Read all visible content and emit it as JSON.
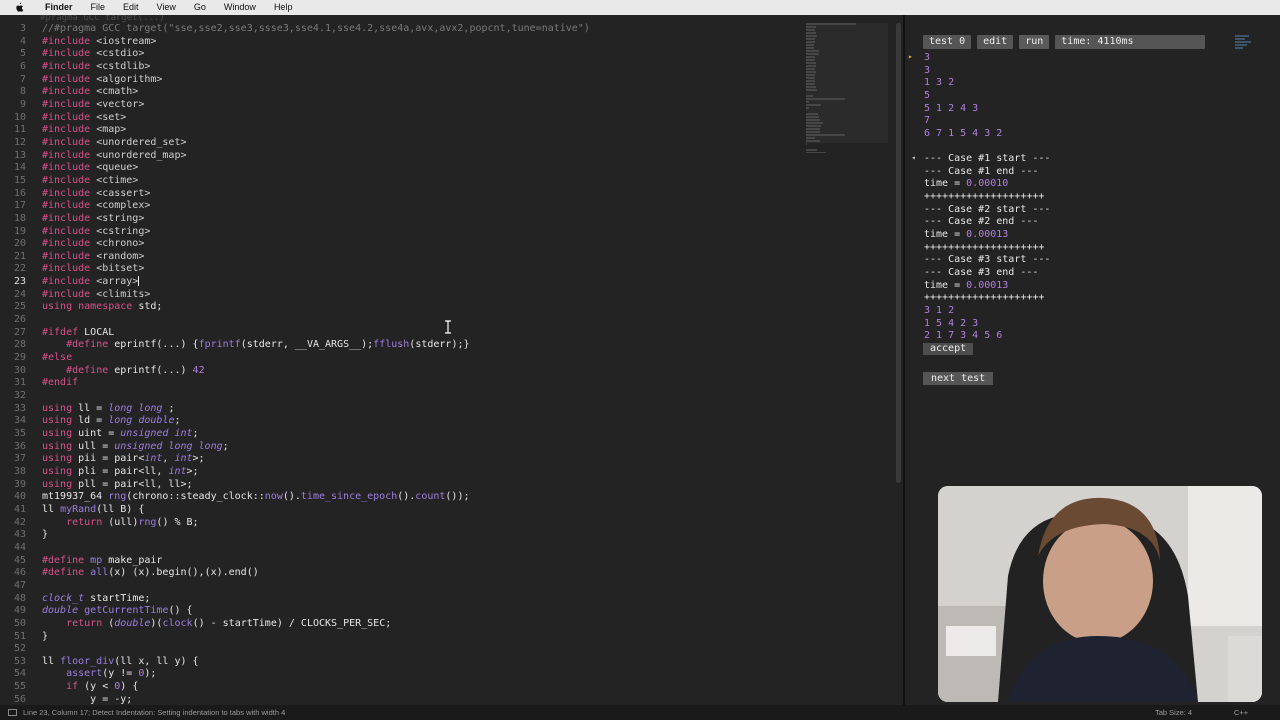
{
  "menubar": {
    "items": [
      "Finder",
      "File",
      "Edit",
      "View",
      "Go",
      "Window",
      "Help"
    ]
  },
  "editor": {
    "partial_top_line": "#pragma GCC target(...)",
    "current_line": 23,
    "lines": [
      {
        "n": "3",
        "segs": [
          [
            "cm",
            "//#pragma GCC target(\"sse,sse2,sse3,ssse3,sse4.1,sse4.2,sse4a,avx,avx2,popcnt,tune=native\")"
          ]
        ]
      },
      {
        "n": "4",
        "segs": [
          [
            "pp",
            "#include "
          ],
          [
            "st",
            "<iostream>"
          ]
        ]
      },
      {
        "n": "5",
        "segs": [
          [
            "pp",
            "#include "
          ],
          [
            "st",
            "<cstdio>"
          ]
        ]
      },
      {
        "n": "6",
        "segs": [
          [
            "pp",
            "#include "
          ],
          [
            "st",
            "<cstdlib>"
          ]
        ]
      },
      {
        "n": "7",
        "segs": [
          [
            "pp",
            "#include "
          ],
          [
            "st",
            "<algorithm>"
          ]
        ]
      },
      {
        "n": "8",
        "segs": [
          [
            "pp",
            "#include "
          ],
          [
            "st",
            "<cmath>"
          ]
        ]
      },
      {
        "n": "9",
        "segs": [
          [
            "pp",
            "#include "
          ],
          [
            "st",
            "<vector>"
          ]
        ]
      },
      {
        "n": "10",
        "segs": [
          [
            "pp",
            "#include "
          ],
          [
            "st",
            "<set>"
          ]
        ]
      },
      {
        "n": "11",
        "segs": [
          [
            "pp",
            "#include "
          ],
          [
            "st",
            "<map>"
          ]
        ]
      },
      {
        "n": "12",
        "segs": [
          [
            "pp",
            "#include "
          ],
          [
            "st",
            "<unordered_set>"
          ]
        ]
      },
      {
        "n": "13",
        "segs": [
          [
            "pp",
            "#include "
          ],
          [
            "st",
            "<unordered_map>"
          ]
        ]
      },
      {
        "n": "14",
        "segs": [
          [
            "pp",
            "#include "
          ],
          [
            "st",
            "<queue>"
          ]
        ]
      },
      {
        "n": "15",
        "segs": [
          [
            "pp",
            "#include "
          ],
          [
            "st",
            "<ctime>"
          ]
        ]
      },
      {
        "n": "16",
        "segs": [
          [
            "pp",
            "#include "
          ],
          [
            "st",
            "<cassert>"
          ]
        ]
      },
      {
        "n": "17",
        "segs": [
          [
            "pp",
            "#include "
          ],
          [
            "st",
            "<complex>"
          ]
        ]
      },
      {
        "n": "18",
        "segs": [
          [
            "pp",
            "#include "
          ],
          [
            "st",
            "<string>"
          ]
        ]
      },
      {
        "n": "19",
        "segs": [
          [
            "pp",
            "#include "
          ],
          [
            "st",
            "<cstring>"
          ]
        ]
      },
      {
        "n": "20",
        "segs": [
          [
            "pp",
            "#include "
          ],
          [
            "st",
            "<chrono>"
          ]
        ]
      },
      {
        "n": "21",
        "segs": [
          [
            "pp",
            "#include "
          ],
          [
            "st",
            "<random>"
          ]
        ]
      },
      {
        "n": "22",
        "segs": [
          [
            "pp",
            "#include "
          ],
          [
            "st",
            "<bitset>"
          ]
        ]
      },
      {
        "n": "23",
        "segs": [
          [
            "pp",
            "#include "
          ],
          [
            "st",
            "<array>"
          ]
        ],
        "caret": true
      },
      {
        "n": "24",
        "segs": [
          [
            "pp",
            "#include "
          ],
          [
            "st",
            "<climits>"
          ]
        ]
      },
      {
        "n": "25",
        "segs": [
          [
            "kw",
            "using "
          ],
          [
            "kw",
            "namespace "
          ],
          [
            "",
            "std;"
          ]
        ]
      },
      {
        "n": "26",
        "segs": []
      },
      {
        "n": "27",
        "segs": [
          [
            "pp",
            "#ifdef "
          ],
          [
            "",
            "LOCAL"
          ]
        ]
      },
      {
        "n": "28",
        "segs": [
          [
            "",
            "    "
          ],
          [
            "pp",
            "#define "
          ],
          [
            "",
            "eprintf(...) {"
          ],
          [
            "fn",
            "fprintf"
          ],
          [
            "",
            "(stderr, __VA_ARGS__);"
          ],
          [
            "fn",
            "fflush"
          ],
          [
            "",
            "(stderr);}"
          ]
        ]
      },
      {
        "n": "29",
        "segs": [
          [
            "pp",
            "#else"
          ]
        ]
      },
      {
        "n": "30",
        "segs": [
          [
            "",
            "    "
          ],
          [
            "pp",
            "#define "
          ],
          [
            "",
            "eprintf(...) "
          ],
          [
            "nm",
            "42"
          ]
        ]
      },
      {
        "n": "31",
        "segs": [
          [
            "pp",
            "#endif"
          ]
        ]
      },
      {
        "n": "32",
        "segs": []
      },
      {
        "n": "33",
        "segs": [
          [
            "kw",
            "using "
          ],
          [
            "",
            "ll = "
          ],
          [
            "ty",
            "long long"
          ],
          [
            "",
            " ;"
          ]
        ]
      },
      {
        "n": "34",
        "segs": [
          [
            "kw",
            "using "
          ],
          [
            "",
            "ld = "
          ],
          [
            "ty",
            "long double"
          ],
          [
            "",
            ";"
          ]
        ]
      },
      {
        "n": "35",
        "segs": [
          [
            "kw",
            "using "
          ],
          [
            "",
            "uint = "
          ],
          [
            "ty",
            "unsigned int"
          ],
          [
            "",
            ";"
          ]
        ]
      },
      {
        "n": "36",
        "segs": [
          [
            "kw",
            "using "
          ],
          [
            "",
            "ull = "
          ],
          [
            "ty",
            "unsigned long long"
          ],
          [
            "",
            ";"
          ]
        ]
      },
      {
        "n": "37",
        "segs": [
          [
            "kw",
            "using "
          ],
          [
            "",
            "pii = pair<"
          ],
          [
            "ty",
            "int"
          ],
          [
            "",
            ", "
          ],
          [
            "ty",
            "int"
          ],
          [
            "",
            ">;"
          ]
        ]
      },
      {
        "n": "38",
        "segs": [
          [
            "kw",
            "using "
          ],
          [
            "",
            "pli = pair<ll, "
          ],
          [
            "ty",
            "int"
          ],
          [
            "",
            ">;"
          ]
        ]
      },
      {
        "n": "39",
        "segs": [
          [
            "kw",
            "using "
          ],
          [
            "",
            "pll = pair<ll, ll>;"
          ]
        ]
      },
      {
        "n": "40",
        "segs": [
          [
            "",
            "mt19937_64 "
          ],
          [
            "fn",
            "rng"
          ],
          [
            "",
            "(chrono::steady_clock::"
          ],
          [
            "fn",
            "now"
          ],
          [
            "",
            "()."
          ],
          [
            "fn",
            "time_since_epoch"
          ],
          [
            "",
            "()."
          ],
          [
            "fn",
            "count"
          ],
          [
            "",
            "());"
          ]
        ]
      },
      {
        "n": "41",
        "segs": [
          [
            "",
            "ll "
          ],
          [
            "fn",
            "myRand"
          ],
          [
            "",
            "(ll B) {"
          ]
        ]
      },
      {
        "n": "42",
        "segs": [
          [
            "",
            "    "
          ],
          [
            "kw",
            "return "
          ],
          [
            "",
            "(ull)"
          ],
          [
            "fn",
            "rng"
          ],
          [
            "",
            "() % B;"
          ]
        ]
      },
      {
        "n": "43",
        "segs": [
          [
            "",
            "}"
          ]
        ]
      },
      {
        "n": "44",
        "segs": []
      },
      {
        "n": "45",
        "segs": [
          [
            "pp",
            "#define "
          ],
          [
            "fn",
            "mp "
          ],
          [
            "",
            "make_pair"
          ]
        ]
      },
      {
        "n": "46",
        "segs": [
          [
            "pp",
            "#define "
          ],
          [
            "fn",
            "all"
          ],
          [
            "",
            "(x) (x).begin(),(x).end()"
          ]
        ]
      },
      {
        "n": "47",
        "segs": []
      },
      {
        "n": "48",
        "segs": [
          [
            "ty",
            "clock_t "
          ],
          [
            "",
            "startTime;"
          ]
        ]
      },
      {
        "n": "49",
        "segs": [
          [
            "ty",
            "double "
          ],
          [
            "fn",
            "getCurrentTime"
          ],
          [
            "",
            "() {"
          ]
        ]
      },
      {
        "n": "50",
        "segs": [
          [
            "",
            "    "
          ],
          [
            "kw",
            "return "
          ],
          [
            "",
            "("
          ],
          [
            "ty",
            "double"
          ],
          [
            "",
            ")("
          ],
          [
            "fn",
            "clock"
          ],
          [
            "",
            "() - startTime) / CLOCKS_PER_SEC;"
          ]
        ]
      },
      {
        "n": "51",
        "segs": [
          [
            "",
            "}"
          ]
        ]
      },
      {
        "n": "52",
        "segs": []
      },
      {
        "n": "53",
        "segs": [
          [
            "",
            "ll "
          ],
          [
            "fn",
            "floor_div"
          ],
          [
            "",
            "(ll x, ll y) {"
          ]
        ]
      },
      {
        "n": "54",
        "segs": [
          [
            "",
            "    "
          ],
          [
            "fn",
            "assert"
          ],
          [
            "",
            "(y != "
          ],
          [
            "nm",
            "0"
          ],
          [
            "",
            ");"
          ]
        ]
      },
      {
        "n": "55",
        "segs": [
          [
            "",
            "    "
          ],
          [
            "kw",
            "if "
          ],
          [
            "",
            "(y < "
          ],
          [
            "nm",
            "0"
          ],
          [
            "",
            ") {"
          ]
        ]
      },
      {
        "n": "56",
        "segs": [
          [
            "",
            "        y = -y;"
          ]
        ]
      }
    ]
  },
  "panel": {
    "toolbar": {
      "test": "test 0",
      "edit": "edit",
      "run": "run",
      "time": "time: 4110ms"
    },
    "input": [
      "3",
      "3",
      "1 3 2",
      "5",
      "5 1 2 4 3",
      "7",
      "6 7 1 5 4 3 2"
    ],
    "output": [
      {
        "t": "--- Case #1 start ---"
      },
      {
        "t": "--- Case #1 end ---"
      },
      {
        "t": "time = ",
        "v": "0.00010"
      },
      {
        "t": "++++++++++++++++++++"
      },
      {
        "t": "--- Case #2 start ---"
      },
      {
        "t": "--- Case #2 end ---"
      },
      {
        "t": "time = ",
        "v": "0.00013"
      },
      {
        "t": "++++++++++++++++++++"
      },
      {
        "t": "--- Case #3 start ---"
      },
      {
        "t": "--- Case #3 end ---"
      },
      {
        "t": "time = ",
        "v": "0.00013"
      },
      {
        "t": "++++++++++++++++++++"
      },
      {
        "t": "",
        "v": "3 1 2"
      },
      {
        "t": "",
        "v": "1 5 4 2 3"
      },
      {
        "t": "",
        "v": "2 1 7 3 4 5 6"
      }
    ],
    "accept": "accept",
    "next_test": "next test"
  },
  "statusbar": {
    "message": "Line 23, Column 17; Detect Indentation: Setting indentation to tabs with width 4",
    "tab_size": "Tab Size: 4",
    "syntax": "C++"
  }
}
